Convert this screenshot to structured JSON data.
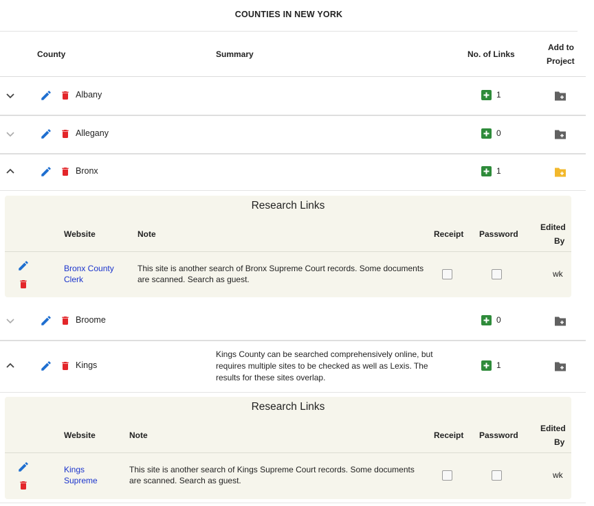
{
  "title": "COUNTIES IN NEW YORK",
  "headers": {
    "county": "County",
    "summary": "Summary",
    "links": "No. of Links",
    "add_line1": "Add to",
    "add_line2": "Project"
  },
  "counties": [
    {
      "name": "Albany",
      "count": "1",
      "summary": "",
      "expanded": false
    },
    {
      "name": "Allegany",
      "count": "0",
      "summary": "",
      "expanded": false
    },
    {
      "name": "Bronx",
      "count": "1",
      "summary": "",
      "expanded": true
    },
    {
      "name": "Broome",
      "count": "0",
      "summary": "",
      "expanded": false
    },
    {
      "name": "Kings",
      "count": "1",
      "summary": "Kings County can be searched comprehensively online, but requires multiple sites to be checked as well as Lexis. The results for these sites overlap.",
      "expanded": true
    }
  ],
  "panel_title": "Research Links",
  "panel_headers": {
    "website": "Website",
    "note": "Note",
    "receipt": "Receipt",
    "password": "Password",
    "edited_line1": "Edited",
    "edited_line2": "By"
  },
  "research_links": {
    "bronx": {
      "website_line1": "Bronx County",
      "website_line2": "Clerk",
      "note_line1": "This site is another search of Bronx Supreme Court records. Some documents",
      "note_line2": "are scanned. Search as guest.",
      "editor": "wk"
    },
    "kings": {
      "website_line1": "Kings",
      "website_line2": "Supreme",
      "note_line1": "This site is another search of Kings Supreme Court records. Some documents",
      "note_line2": "are scanned. Search as guest.",
      "editor": "wk"
    }
  },
  "colors": {
    "add_link_green": "#2e8b3a",
    "folder_gray": "#616161",
    "folder_active": "#f2b82c",
    "pencil_blue": "#1f6fd0",
    "trash_red": "#e3262a",
    "link_blue": "#1a33cc",
    "panel_bg": "#f6f5ec"
  },
  "icons": [
    "chevron-down-icon",
    "chevron-up-icon",
    "pencil-icon",
    "trash-icon",
    "add-box-icon",
    "folder-add-icon"
  ]
}
